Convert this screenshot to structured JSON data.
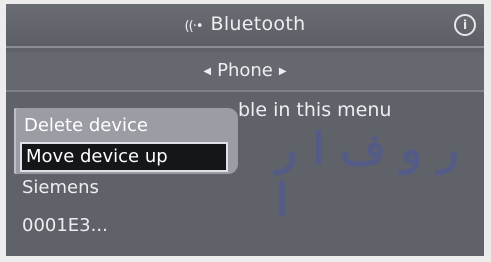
{
  "header": {
    "title": "Bluetooth",
    "bluetooth_icon_glyph": "((·•",
    "info_icon_glyph": "i"
  },
  "subheader": {
    "label": "Phone",
    "left_arrow": "◀",
    "right_arrow": "▶"
  },
  "background_text": "ble in this menu",
  "popup_menu": {
    "items": [
      {
        "label": "Delete device"
      },
      {
        "label": "Move device up"
      }
    ],
    "selected_index": 1
  },
  "device": {
    "name": "Siemens",
    "address": "0001E3..."
  },
  "watermark": {
    "text": "ر و ف ا ر ا",
    "color": "#3c50be"
  }
}
